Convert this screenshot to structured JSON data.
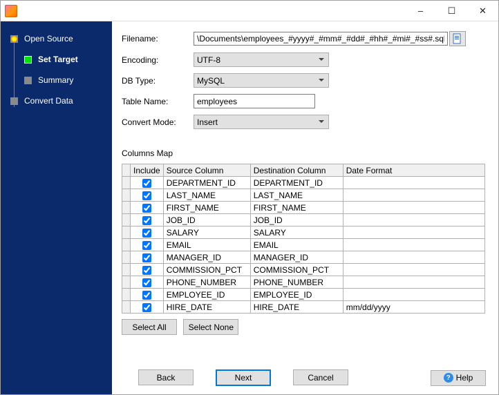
{
  "window": {
    "title": ""
  },
  "sidebar": {
    "steps": [
      {
        "label": "Open Source"
      },
      {
        "label": "Set Target"
      },
      {
        "label": "Summary"
      },
      {
        "label": "Convert Data"
      }
    ]
  },
  "form": {
    "filename_label": "Filename:",
    "filename_value": "\\Documents\\employees_#yyyy#_#mm#_#dd#_#hh#_#mi#_#ss#.sql",
    "encoding_label": "Encoding:",
    "encoding_value": "UTF-8",
    "dbtype_label": "DB Type:",
    "dbtype_value": "MySQL",
    "tablename_label": "Table Name:",
    "tablename_value": "employees",
    "convertmode_label": "Convert Mode:",
    "convertmode_value": "Insert"
  },
  "columns_map": {
    "title": "Columns Map",
    "headers": {
      "include": "Include",
      "source": "Source Column",
      "dest": "Destination Column",
      "format": "Date Format"
    },
    "rows": [
      {
        "include": true,
        "source": "DEPARTMENT_ID",
        "dest": "DEPARTMENT_ID",
        "format": ""
      },
      {
        "include": true,
        "source": "LAST_NAME",
        "dest": "LAST_NAME",
        "format": ""
      },
      {
        "include": true,
        "source": "FIRST_NAME",
        "dest": "FIRST_NAME",
        "format": ""
      },
      {
        "include": true,
        "source": "JOB_ID",
        "dest": "JOB_ID",
        "format": ""
      },
      {
        "include": true,
        "source": "SALARY",
        "dest": "SALARY",
        "format": ""
      },
      {
        "include": true,
        "source": "EMAIL",
        "dest": "EMAIL",
        "format": ""
      },
      {
        "include": true,
        "source": "MANAGER_ID",
        "dest": "MANAGER_ID",
        "format": ""
      },
      {
        "include": true,
        "source": "COMMISSION_PCT",
        "dest": "COMMISSION_PCT",
        "format": ""
      },
      {
        "include": true,
        "source": "PHONE_NUMBER",
        "dest": "PHONE_NUMBER",
        "format": ""
      },
      {
        "include": true,
        "source": "EMPLOYEE_ID",
        "dest": "EMPLOYEE_ID",
        "format": ""
      },
      {
        "include": true,
        "source": "HIRE_DATE",
        "dest": "HIRE_DATE",
        "format": "mm/dd/yyyy"
      }
    ]
  },
  "buttons": {
    "select_all": "Select All",
    "select_none": "Select None",
    "back": "Back",
    "next": "Next",
    "cancel": "Cancel",
    "help": "Help"
  }
}
